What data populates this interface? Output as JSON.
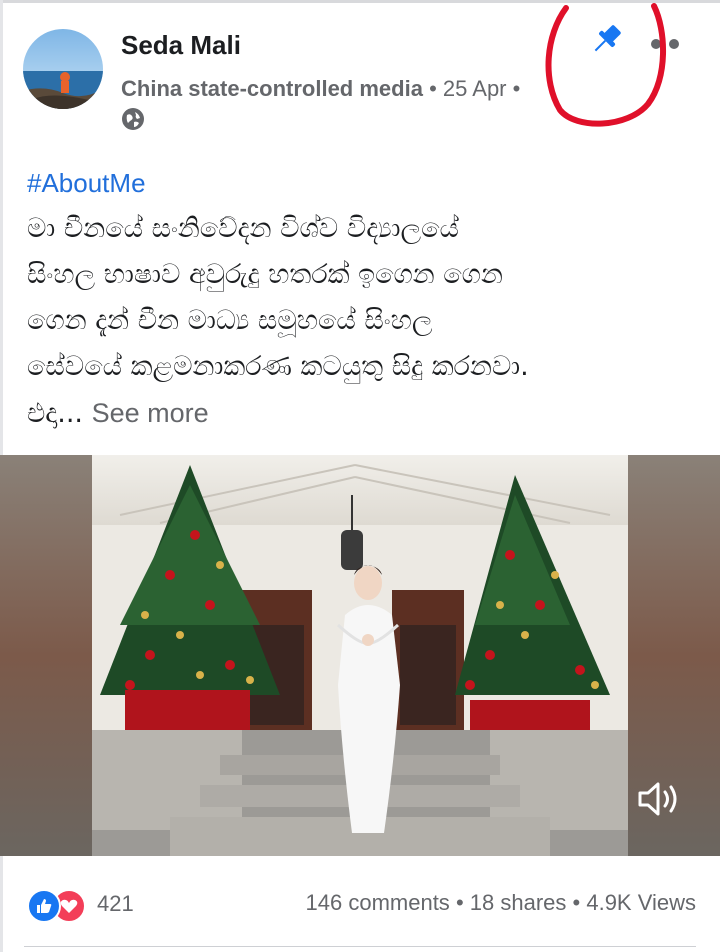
{
  "post": {
    "author": "Seda Mali",
    "source_label": "China state-controlled media",
    "separator_dot": "•",
    "date": "25 Apr",
    "trailing_dot": "•",
    "hashtag": "#AboutMe",
    "body_lines": [
      "මා චීනයේ සංනිවේදන විශ්ව විද්‍යාලයේ",
      "සිංහල භාෂාව අවුරුදු හතරක් ඉගෙන ගෙන",
      "ගෙන දැන් චීන මාධ්‍ය සමූහයේ සිංහල",
      "සේවයේ කළමනාකරණ කටයුතු සිදු කරනවා.",
      "එදා..."
    ],
    "see_more": "See more"
  },
  "footer": {
    "reaction_count": "421",
    "comments": "146 comments",
    "shares": "18 shares",
    "views": "4.9K Views",
    "dot": "•"
  },
  "icons": {
    "pin": "pin-icon",
    "more": "more-options-icon",
    "globe": "globe-icon",
    "speaker": "volume-icon",
    "like": "like-reaction-icon",
    "love": "love-reaction-icon"
  },
  "colors": {
    "hashtag": "#216fdb",
    "pin": "#1877f2",
    "annotation_circle": "#e0102a",
    "like": "#1877f2",
    "love": "#f33e58"
  }
}
